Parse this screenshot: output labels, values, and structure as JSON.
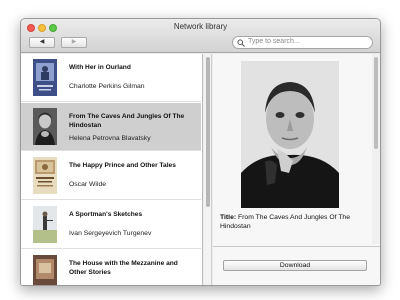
{
  "window": {
    "title": "Network library"
  },
  "toolbar": {
    "back_label": "◀",
    "forward_label": "▶",
    "search_placeholder": "Type to search..."
  },
  "books": [
    {
      "title": "With Her in Ourland",
      "author": "Charlotte Perkins Gilman",
      "selected": false
    },
    {
      "title": "From The Caves And Jungles Of The Hindostan",
      "author": "Helena Petrovna Blavatsky",
      "selected": true
    },
    {
      "title": "The Happy Prince and Other Tales",
      "author": "Oscar Wilde",
      "selected": false
    },
    {
      "title": "A Sportman's Sketches",
      "author": "Ivan Sergeyevich Turgenev",
      "selected": false
    },
    {
      "title": "The House with the Mezzanine and Other Stories",
      "author": "",
      "selected": false
    }
  ],
  "detail": {
    "title_label": "Title:",
    "title_value": "From The Caves And Jungles Of The Hindostan",
    "download_label": "Download"
  }
}
